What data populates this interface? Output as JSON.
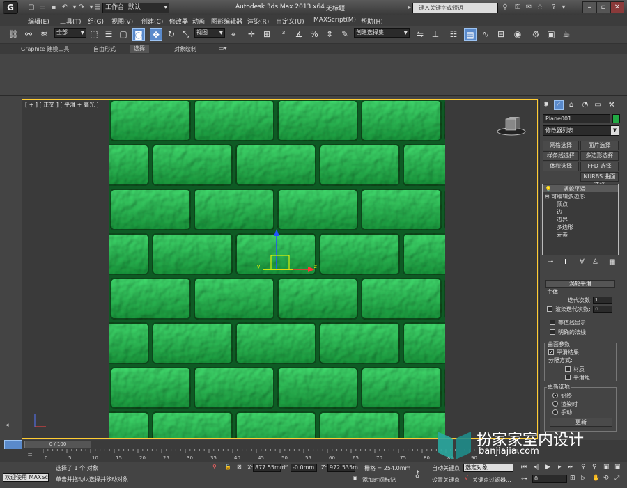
{
  "titlebar": {
    "workspace": "工作台: 默认",
    "app_title": "Autodesk 3ds Max  2013 x64",
    "doc_title": "无标题",
    "search_placeholder": "键入关键字或短语"
  },
  "menu": [
    "编辑(E)",
    "工具(T)",
    "组(G)",
    "视图(V)",
    "创建(C)",
    "修改器",
    "动画",
    "图形编辑器",
    "渲染(R)",
    "自定义(U)",
    "MAXScript(M)",
    "帮助(H)"
  ],
  "toolbar": {
    "filter": "全部",
    "ref_coord": "视图",
    "selection_set": "创建选择集"
  },
  "ribbon_tabs": [
    "Graphite 建模工具",
    "自由形式",
    "选择",
    "对象绘制"
  ],
  "viewport": {
    "label": "[ + ] [ 正交 ] [ 平滑 + 高光 ]",
    "wall_color": "#22aa44"
  },
  "command_panel": {
    "object_name": "Plane001",
    "modifier_list": "修改器列表",
    "modifier_buttons": [
      "网格选择",
      "面片选择",
      "样条线选择",
      "多边形选择",
      "体积选择",
      "FFD 选择",
      "NURBS 曲面选择"
    ],
    "stack": {
      "top": "涡轮平滑",
      "base": "可编辑多边形",
      "subs": [
        "顶点",
        "边",
        "边界",
        "多边形",
        "元素"
      ]
    },
    "rollout_title": "涡轮平滑",
    "main_group": "主体",
    "iterations_label": "迭代次数:",
    "iterations_value": "1",
    "render_iters_label": "渲染迭代次数:",
    "render_iters_value": "0",
    "isoline_label": "等值线显示",
    "explicit_normals_label": "明确的法线",
    "surface_params": "曲面参数",
    "smooth_result": "平滑结果",
    "separate_by": "分隔方式:",
    "materials": "材质",
    "smoothing_groups": "平滑组",
    "update_options": "更新选项",
    "always": "始终",
    "when_rendering": "渲染时",
    "manually": "手动",
    "update_btn": "更新"
  },
  "timeline": {
    "slider": "0 / 100",
    "ticks": [
      "0",
      "5",
      "10",
      "15",
      "20",
      "25",
      "30",
      "35",
      "40",
      "45",
      "50",
      "55",
      "60",
      "65",
      "70",
      "75",
      "80",
      "85",
      "90"
    ]
  },
  "status": {
    "welcome": "欢迎使用  MAXSc",
    "selected": "选择了 1 个 对象",
    "prompt": "单击并拖动以选择并移动对象",
    "x_label": "X:",
    "x": "877.55mm",
    "y_label": "Y:",
    "y": "-0.0mm",
    "z_label": "Z:",
    "z": "972.535m",
    "grid": "栅格 = 254.0mm",
    "add_time_tag": "添加时间标记",
    "auto_key": "自动关键点",
    "selected_obj": "选定对象",
    "set_key": "设置关键点",
    "key_filters": "关键点过滤器...",
    "frame": "0"
  },
  "watermark": {
    "cn": "扮家家室内设计",
    "url": "banjiajia.com"
  }
}
